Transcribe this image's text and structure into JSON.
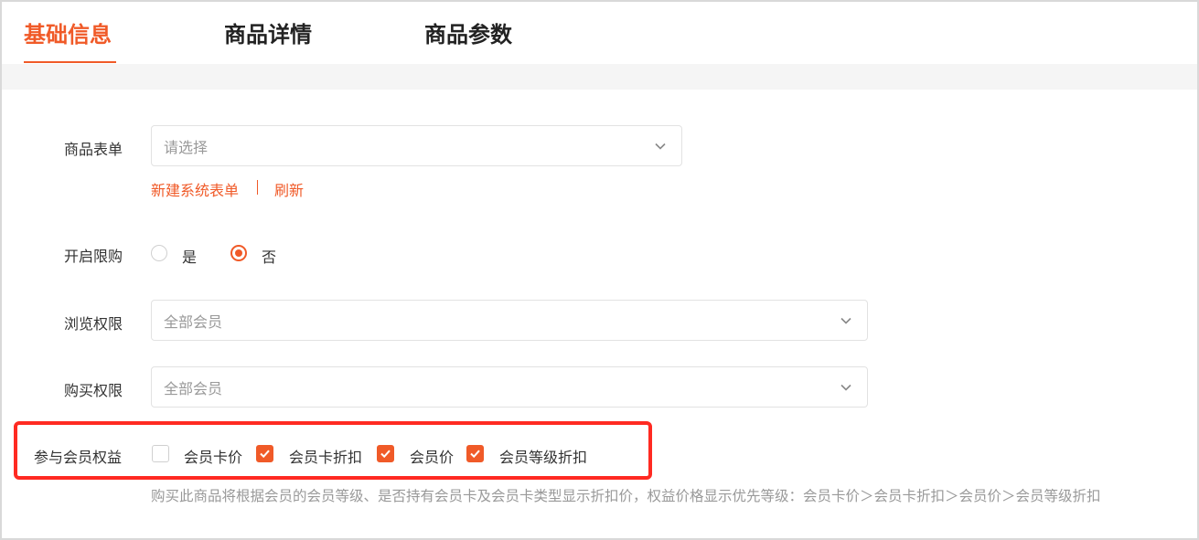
{
  "tabs": [
    {
      "label": "基础信息",
      "active": true
    },
    {
      "label": "商品详情",
      "active": false
    },
    {
      "label": "商品参数",
      "active": false
    }
  ],
  "form": {
    "product_form": {
      "label": "商品表单",
      "placeholder": "请选择",
      "links": {
        "create": "新建系统表单",
        "refresh": "刷新"
      }
    },
    "purchase_limit": {
      "label": "开启限购",
      "options": [
        {
          "label": "是",
          "checked": false
        },
        {
          "label": "否",
          "checked": true
        }
      ]
    },
    "browse_permission": {
      "label": "浏览权限",
      "value": "全部会员"
    },
    "buy_permission": {
      "label": "购买权限",
      "value": "全部会员"
    },
    "member_benefits": {
      "label": "参与会员权益",
      "options": [
        {
          "label": "会员卡价",
          "checked": false
        },
        {
          "label": "会员卡折扣",
          "checked": true
        },
        {
          "label": "会员价",
          "checked": true
        },
        {
          "label": "会员等级折扣",
          "checked": true
        }
      ],
      "hint": "购买此商品将根据会员的会员等级、是否持有会员卡及会员卡类型显示折扣价，权益价格显示优先等级：会员卡价＞会员卡折扣＞会员价＞会员等级折扣"
    }
  },
  "icons": {
    "dropdown": "chevron-down-icon",
    "check": "check-icon"
  },
  "colors": {
    "accent": "#f05a28",
    "highlight_border": "#ff2a22",
    "placeholder": "#999999"
  }
}
